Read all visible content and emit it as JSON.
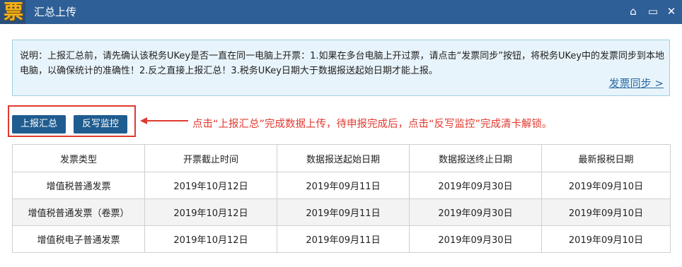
{
  "window": {
    "logo_char": "票",
    "title": "汇总上传",
    "controls": [
      "⌂",
      "▭",
      "✕"
    ]
  },
  "notice": {
    "text": "说明：上报汇总前，请先确认该税务UKey是否一直在同一电脑上开票：1.如果在多台电脑上开过票，请点击“发票同步”按钮，将税务UKey中的发票同步到本地电脑，以确保统计的准确性！2.反之直接上报汇总！3.税务UKey日期大于数据报送起始日期才能上报。",
    "link_label": "发票同步 >"
  },
  "toolbar": {
    "upload_label": "上报汇总",
    "writeback_label": "反写监控"
  },
  "annotation": "点击“上报汇总”完成数据上传，待申报完成后，点击“反写监控”完成清卡解锁。",
  "colors": {
    "titlebar": "#2e5f96",
    "button": "#1f5c8f",
    "annotation_red": "#e03a2f",
    "notice_bg": "#e8f4fb"
  },
  "table": {
    "headers": [
      "发票类型",
      "开票截止时间",
      "数据报送起始日期",
      "数据报送终止日期",
      "最新报税日期"
    ],
    "rows": [
      [
        "增值税普通发票",
        "2019年10月12日",
        "2019年09月11日",
        "2019年09月30日",
        "2019年09月10日"
      ],
      [
        "增值税普通发票（卷票）",
        "2019年10月12日",
        "2019年09月11日",
        "2019年09月30日",
        "2019年09月10日"
      ],
      [
        "增值税电子普通发票",
        "2019年10月12日",
        "2019年09月11日",
        "2019年09月30日",
        "2019年09月10日"
      ]
    ]
  }
}
